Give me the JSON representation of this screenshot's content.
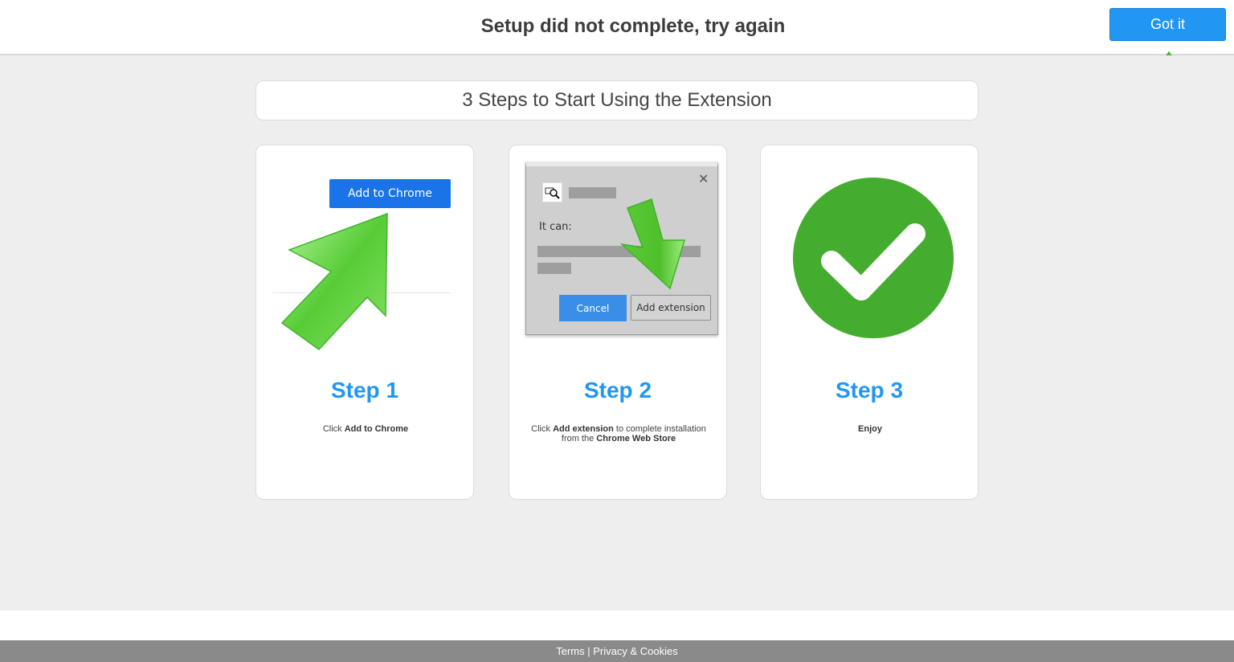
{
  "header": {
    "title": "Setup did not complete, try again",
    "got_it_label": "Got it"
  },
  "main": {
    "heading": "3 Steps to Start Using the Extension"
  },
  "steps": [
    {
      "title": "Step 1",
      "desc_prefix": "Click ",
      "desc_bold": "Add to Chrome",
      "button_label": "Add to Chrome"
    },
    {
      "title": "Step 2",
      "desc_prefix": "Click ",
      "desc_bold": "Add extension",
      "desc_middle": " to complete installation from the ",
      "desc_bold2": "Chrome Web Store",
      "dialog_text": "It can:",
      "dialog_close": "✕",
      "cancel_label": "Cancel",
      "add_extension_label": "Add extension"
    },
    {
      "title": "Step 3",
      "desc_bold": "Enjoy"
    }
  ],
  "footer": {
    "terms": "Terms",
    "separator": " | ",
    "privacy": "Privacy & Cookies"
  },
  "colors": {
    "accent": "#2196f3",
    "arrow_green": "#5ccd3a",
    "check_green": "#44ac2e"
  },
  "icons": [
    "arrow-up-icon",
    "arrow-diagonal-icon",
    "arrow-down-icon",
    "close-icon",
    "extension-search-icon",
    "checkmark-icon"
  ]
}
